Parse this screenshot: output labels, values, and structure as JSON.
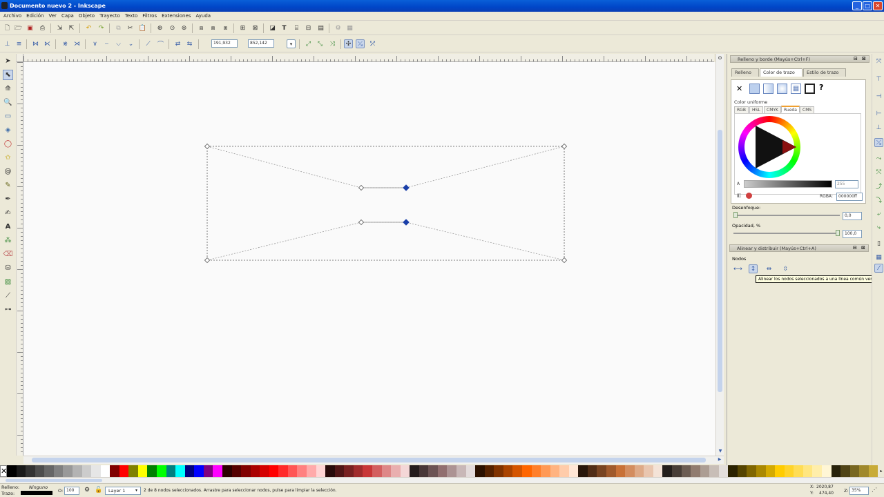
{
  "window": {
    "title": "Documento nuevo 2 - Inkscape",
    "minimize": "_",
    "maximize": "□",
    "close": "✕"
  },
  "menu": [
    "Archivo",
    "Edición",
    "Ver",
    "Capa",
    "Objeto",
    "Trayecto",
    "Texto",
    "Filtros",
    "Extensiones",
    "Ayuda"
  ],
  "node_toolbar": {
    "x_label": "X:",
    "x_value": "191,932",
    "y_label": "Y:",
    "y_value": "852,142",
    "unit": "px"
  },
  "fill_stroke": {
    "title": "Relleno y borde (Mayús+Ctrl+F)",
    "tabs": [
      "Relleno",
      "Color de trazo",
      "Estilo de trazo"
    ],
    "active_tab": 1,
    "paint_x": "✕",
    "paint_unknown": "?",
    "mode_label": "Color uniforme",
    "subtabs": [
      "RGB",
      "HSL",
      "CMYK",
      "Rueda",
      "CMS"
    ],
    "active_subtab": 3,
    "alpha_label": "A",
    "alpha_value": "255",
    "rgba_label": "RGBA:",
    "rgba_value": "000000ff",
    "blur_label": "Desenfoque:",
    "blur_value": "0,0",
    "opacity_label": "Opacidad, %",
    "opacity_value": "100,0"
  },
  "align": {
    "title": "Alinear y distribuir (Mayús+Ctrl+A)",
    "section_label": "Nodos",
    "tooltip": "Alinear los nodos seleccionados a una línea común vertical"
  },
  "status": {
    "fill_label": "Relleno:",
    "stroke_label": "Trazo:",
    "stroke_value": "Ninguno",
    "opacity_label": "O:",
    "opacity_value": "100",
    "layer": "Layer 1",
    "message": "2 de 8 nodos seleccionados. Arrastre para seleccionar nodos, pulse para limpiar la selección.",
    "x_label": "X:",
    "x_value": "2020,87",
    "y_label": "Y:",
    "y_value": "474,40",
    "zoom_label": "Z:",
    "zoom_value": "35%"
  },
  "colors": {
    "accent": "#0046c8",
    "canvas": "#fafafa",
    "selected_node": "#1a3fa8",
    "palette": [
      "#000000",
      "#1a1a1a",
      "#333333",
      "#4d4d4d",
      "#666666",
      "#808080",
      "#999999",
      "#b3b3b3",
      "#cccccc",
      "#e6e6e6",
      "#ffffff",
      "#800000",
      "#ff0000",
      "#808000",
      "#ffff00",
      "#008000",
      "#00ff00",
      "#008080",
      "#00ffff",
      "#000080",
      "#0000ff",
      "#800080",
      "#ff00ff",
      "#2b0000",
      "#550000",
      "#800000",
      "#aa0000",
      "#d40000",
      "#ff0000",
      "#ff2a2a",
      "#ff5555",
      "#ff8080",
      "#ffaaaa",
      "#ffd5d5",
      "#280b0b",
      "#501616",
      "#782121",
      "#a02c2c",
      "#c83737",
      "#d35f5f",
      "#de8787",
      "#e9afaf",
      "#f4d7d7",
      "#241c1c",
      "#483737",
      "#6c5353",
      "#916f6f",
      "#ac9393",
      "#c8b7b7",
      "#e3dbdb",
      "#2b1100",
      "#552200",
      "#803300",
      "#aa4400",
      "#d45500",
      "#ff6600",
      "#ff7f2a",
      "#ff9955",
      "#ffb380",
      "#ffccaa",
      "#ffe6d5",
      "#28170b",
      "#502d16",
      "#784421",
      "#a05a2c",
      "#c87137",
      "#d38d5f",
      "#deaa87",
      "#e9c6af",
      "#f4e3d7",
      "#241f1c",
      "#483e37",
      "#6c5d53",
      "#917c6f",
      "#ac9d93",
      "#c8beb7",
      "#e3dedb",
      "#2b2200",
      "#554400",
      "#806600",
      "#aa8800",
      "#d4aa00",
      "#ffcc00",
      "#ffd42a",
      "#ffdd55",
      "#ffe680",
      "#ffeeaa",
      "#fff6d5",
      "#28220b",
      "#504416",
      "#786721",
      "#a0892c",
      "#c8ab37"
    ]
  }
}
